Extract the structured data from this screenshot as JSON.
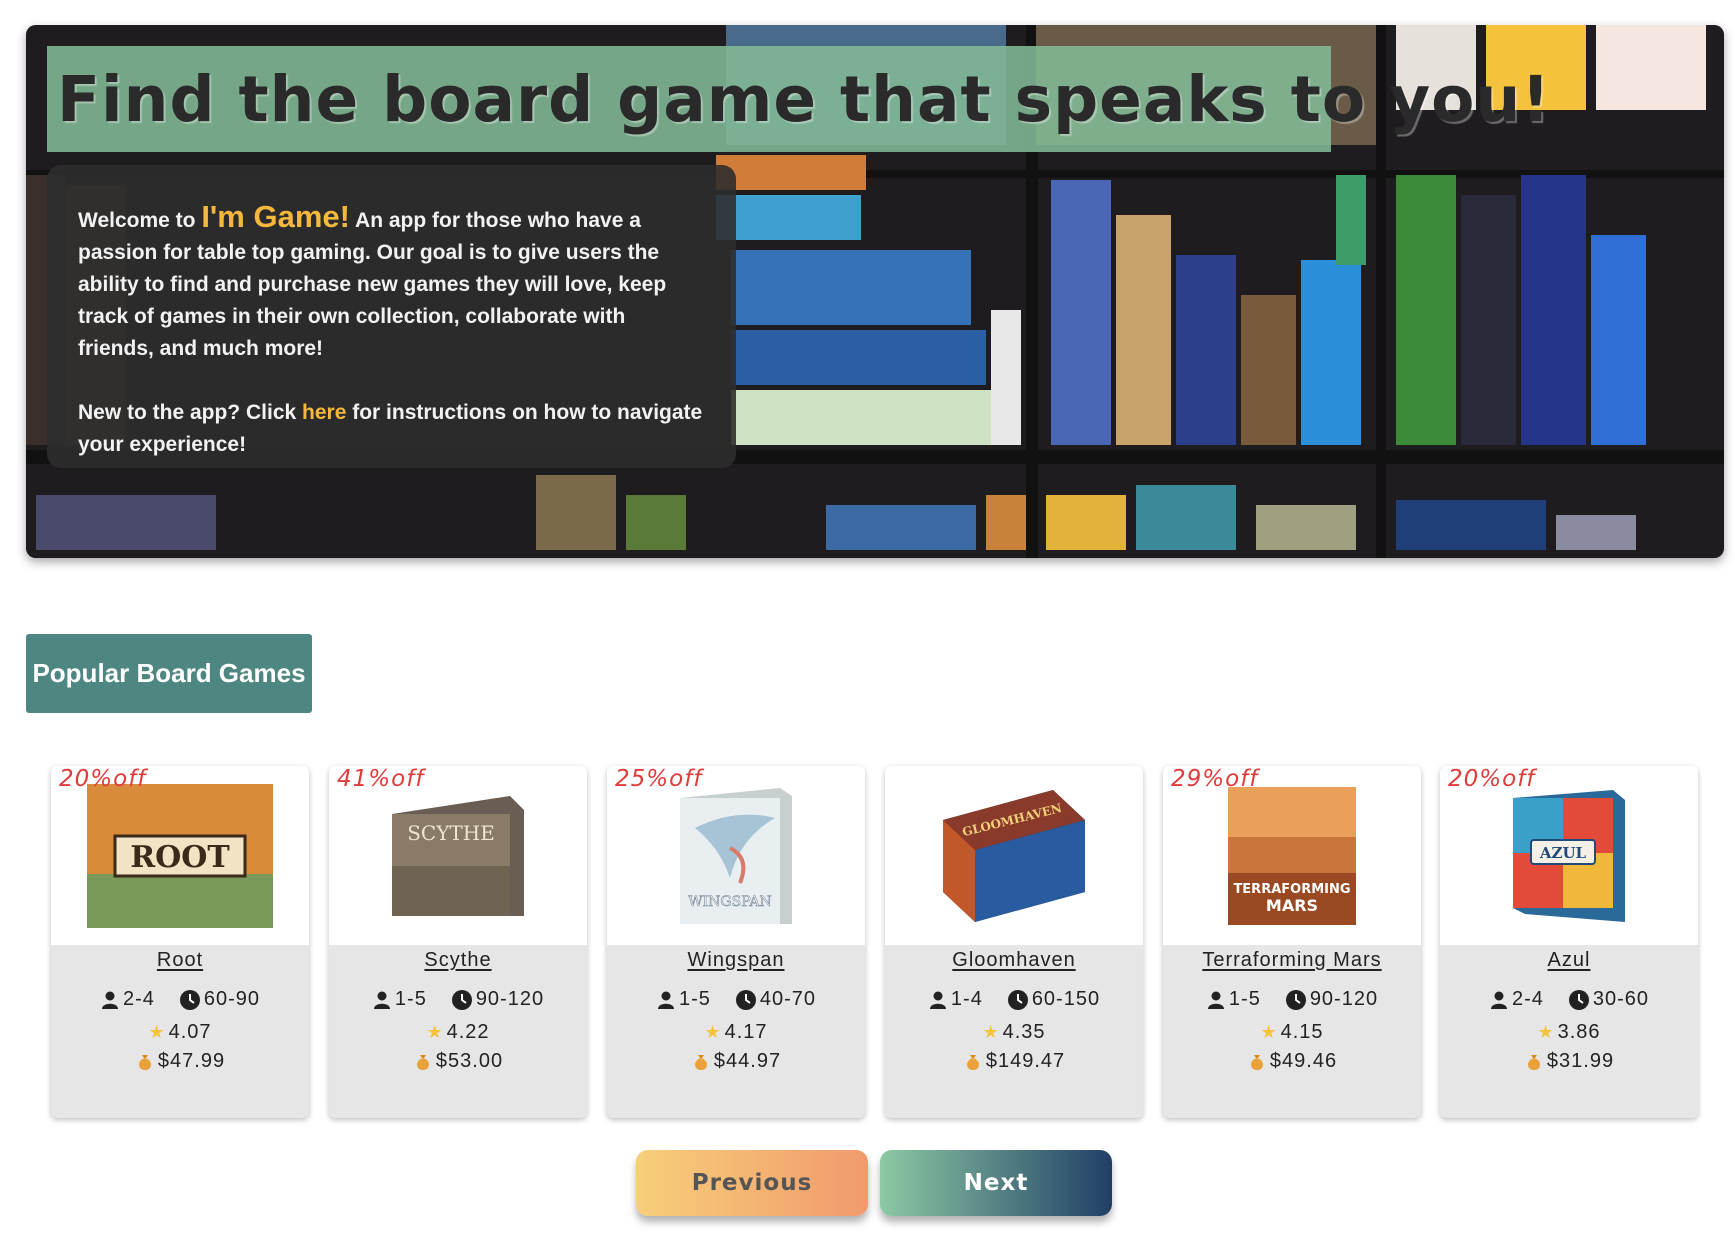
{
  "hero": {
    "title": "Find the board game that speaks to you!",
    "welcome": {
      "prefix": "Welcome to ",
      "brand": "I'm Game!",
      "body": " An app for those who have a passion for table top gaming. Our goal is to give users the ability to find and purchase new games they will love, keep track of games in their own collection, collaborate with friends, and much more!",
      "help_prefix": "New to the app? Click ",
      "help_link": "here",
      "help_suffix": " for instructions on how to navigate your experience!"
    }
  },
  "section_title": "Popular Board Games",
  "games": [
    {
      "discount": "20%off",
      "name": "Root",
      "players": "2-4",
      "time": "60-90",
      "rating": "4.07",
      "price": "$47.99"
    },
    {
      "discount": "41%off",
      "name": "Scythe",
      "players": "1-5",
      "time": "90-120",
      "rating": "4.22",
      "price": "$53.00"
    },
    {
      "discount": "25%off",
      "name": "Wingspan",
      "players": "1-5",
      "time": "40-70",
      "rating": "4.17",
      "price": "$44.97"
    },
    {
      "discount": "",
      "name": "Gloomhaven",
      "players": "1-4",
      "time": "60-150",
      "rating": "4.35",
      "price": "$149.47"
    },
    {
      "discount": "29%off",
      "name": "Terraforming Mars",
      "players": "1-5",
      "time": "90-120",
      "rating": "4.15",
      "price": "$49.46"
    },
    {
      "discount": "20%off",
      "name": "Azul",
      "players": "2-4",
      "time": "30-60",
      "rating": "3.86",
      "price": "$31.99"
    }
  ],
  "pager": {
    "previous": "Previous",
    "next": "Next"
  },
  "icons": {
    "players": "person-icon",
    "time": "clock-icon",
    "rating": "star-icon",
    "price": "money-bag-icon"
  },
  "colors": {
    "accent": "#f5b83d",
    "section": "#4e8782",
    "discount": "#e03b3b",
    "title_band": "#82b996"
  }
}
